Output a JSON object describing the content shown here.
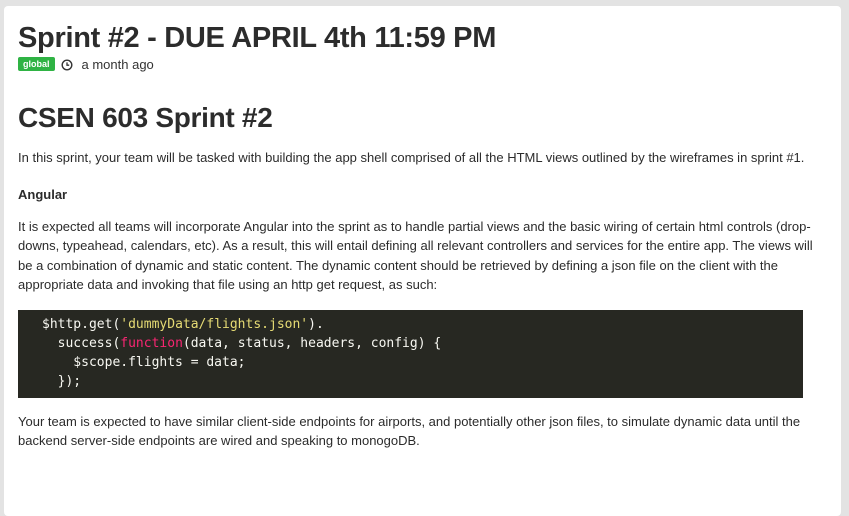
{
  "post": {
    "title": "Sprint #2 - DUE APRIL 4th 11:59 PM",
    "badge": "global",
    "time_ago": "a month ago",
    "icons": {
      "time": "clock-icon"
    }
  },
  "content": {
    "title": "CSEN 603 Sprint #2",
    "intro": "In this sprint, your team will be tasked with building the app shell comprised of all the HTML views outlined by the wireframes in sprint #1.",
    "section_heading": "Angular",
    "angular_paragraph": "It is expected all teams will incorporate Angular into the sprint as to handle partial views and the basic wiring of certain html controls (drop-downs, typeahead, calendars, etc). As a result, this will entail defining all relevant controllers and services for the entire app. The views will be a combination of dynamic and static content. The dynamic content should be retrieved by defining a json file on the client with the appropriate data and invoking that file using an http get request, as such:",
    "code": {
      "line1_a": "$http.get(",
      "line1_str": "'dummyData/flights.json'",
      "line1_b": ").",
      "line2_a": "  success(",
      "line2_kw": "function",
      "line2_b": "(data, status, headers, config) {",
      "line3": "    $scope.flights = data;",
      "line4": "  });"
    },
    "closing_paragraph": "Your team is expected to have similar client-side endpoints for airports, and potentially other json files, to simulate dynamic data until the backend server-side endpoints are wired and speaking to monogoDB."
  },
  "colors": {
    "badge": "#2fb344",
    "code_background": "#272822",
    "code_string": "#e6db74",
    "code_keyword": "#f92672"
  }
}
